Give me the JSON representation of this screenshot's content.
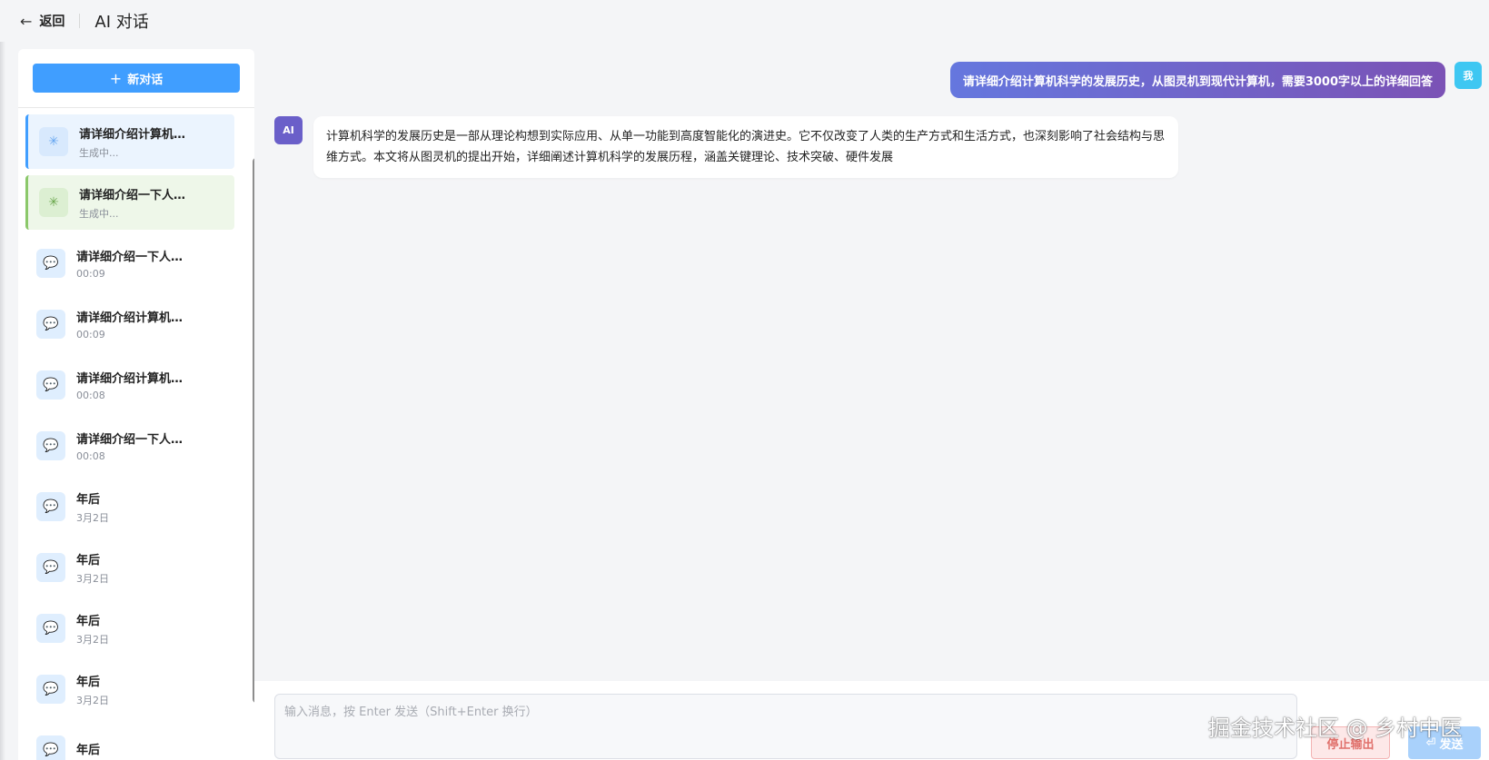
{
  "header": {
    "back_label": "返回",
    "title": "AI 对话"
  },
  "sidebar": {
    "new_chat_label": "新对话",
    "conversations": [
      {
        "title": "请详细介绍计算机…",
        "subtitle": "生成中...",
        "state": "loading",
        "accent": "#409eff"
      },
      {
        "title": "请详细介绍一下人…",
        "subtitle": "生成中...",
        "state": "loading",
        "accent": "#8bc86a"
      },
      {
        "title": "请详细介绍一下人…",
        "subtitle": "00:09",
        "state": "done"
      },
      {
        "title": "请详细介绍计算机…",
        "subtitle": "00:09",
        "state": "done"
      },
      {
        "title": "请详细介绍计算机…",
        "subtitle": "00:08",
        "state": "done"
      },
      {
        "title": "请详细介绍一下人…",
        "subtitle": "00:08",
        "state": "done"
      },
      {
        "title": "年后",
        "subtitle": "3月2日",
        "state": "done"
      },
      {
        "title": "年后",
        "subtitle": "3月2日",
        "state": "done"
      },
      {
        "title": "年后",
        "subtitle": "3月2日",
        "state": "done"
      },
      {
        "title": "年后",
        "subtitle": "3月2日",
        "state": "done"
      },
      {
        "title": "年后",
        "subtitle": "",
        "state": "done"
      }
    ]
  },
  "chat": {
    "user_message": "请详细介绍计算机科学的发展历史，从图灵机到现代计算机，需要3000字以上的详细回答",
    "user_avatar": "我",
    "ai_avatar": "AI",
    "ai_message": "计算机科学的发展历史是一部从理论构想到实际应用、从单一功能到高度智能化的演进史。它不仅改变了人类的生产方式和生活方式，也深刻影响了社会结构与思维方式。本文将从图灵机的提出开始，详细阐述计算机科学的发展历程，涵盖关键理论、技术突破、硬件发展"
  },
  "input": {
    "placeholder": "输入消息，按 Enter 发送（Shift+Enter 换行）",
    "value": "",
    "stop_label": "停止输出",
    "send_label": "发送"
  },
  "watermark": "掘金技术社区 @ 乡村中医",
  "icons": {
    "back": "arrow-left-icon",
    "new_chat": "plus-icon",
    "loading": "spinner-icon",
    "chat": "chat-bubble-icon",
    "send": "send-icon"
  },
  "colors": {
    "primary": "#409eff",
    "user_bubble_start": "#6577de",
    "user_bubble_end": "#7b52b5",
    "user_avatar": "#3ec7f2",
    "ai_avatar": "#6a5fc9",
    "stop": "#e0706b"
  }
}
